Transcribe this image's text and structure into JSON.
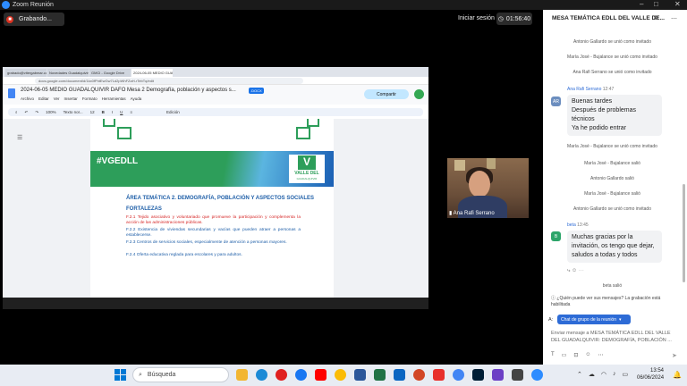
{
  "window": {
    "title": "Zoom Reunión",
    "controls": [
      "–",
      "□",
      "✕"
    ]
  },
  "zoom": {
    "recording_label": "Grabando...",
    "start_label": "Iniciar sesión",
    "timer": "01:56:40"
  },
  "shared_screen": {
    "tabs": [
      "grabado@vitergabmar.com...",
      "Novedades Guadalquivir...",
      "GMCl - Google Drive",
      "2024-06-05 MEDIO GUADALQ..."
    ],
    "url": "docs.google.com/document/d/1kx0fPhtEwGw7Ld2pWhFZaH-rTebTq/edit",
    "doc_title": "2024-06-05 MEDIO GUADALQUIVIR DAFO Mesa 2 Demografía, población y aspectos s...",
    "doc_badge": ".DOCX",
    "menus": [
      "Archivo",
      "Editar",
      "Ver",
      "Insertar",
      "Formato",
      "Herramientas",
      "Ayuda"
    ],
    "share_label": "Compartir",
    "toolbar": {
      "zoom": "100%",
      "style": "Texto nor...",
      "font_size": "12",
      "mode": "Edición"
    },
    "banner_tag": "#VGEDLL",
    "logo_line1": "VALLE DEL",
    "logo_line2": "GUADALQUIVIR",
    "area_title": "ÁREA TEMÁTICA 2. DEMOGRAFÍA, POBLACIÓN Y ASPECTOS SOCIALES",
    "section": "FORTALEZAS",
    "items": [
      "F.2.1  Tejido asociativo y voluntariado que promueve la participación y complementa la acción de las administraciones públicas.",
      "F.2.2  Existencia de viviendas secundarias y vacías que pueden atraer a personas a establecerse.",
      "F.2.3  Centros de servicios sociales, especialmente de atención a personas mayores.",
      "F.2.4  Oferta educativa reglada para escolares y para adultos."
    ]
  },
  "video": {
    "participant_name": "Ana Rafi Serrano"
  },
  "chat": {
    "title": "MESA TEMÁTICA EDLL DEL VALLE DE...",
    "system_top": [
      "Antonio Gallardo se unió como invitado",
      "María José - Bujalance se unió como invitado",
      "Ana Rafi Serrano se unió como invitado"
    ],
    "message1": {
      "avatar": "AR",
      "sender": "Ana Rafi Serrano",
      "time": "12:47",
      "lines": [
        "Buenas tardes",
        "Después de problemas técnicos",
        "Ya he podido entrar"
      ]
    },
    "system_mid": [
      "María José - Bujalance se unió como invitado",
      "María José - Bujalance salió",
      "Antonio Gallardo salió",
      "María José - Bujalance salió",
      "Antonio Gallardo se unió como invitado"
    ],
    "message2": {
      "avatar": "B",
      "sender": "beta",
      "time": "13:45",
      "text": "Muchas gracias por la invitación, os tengo que dejar, saludos a todas y todos"
    },
    "system_bottom": "beta salió",
    "notice": "¿Quién puede ver sus mensajes? La grabación está habilitada",
    "to_label": "A:",
    "to_value": "Chat de grupo de la reunión",
    "input_placeholder": "Enviar mensaje a MESA TEMÁTICA EDLL DEL VALLE DEL GUADALQUIVIR: DEMOGRAFÍA, POBLACIÓN ..."
  },
  "taskbar": {
    "search_placeholder": "Búsqueda",
    "time": "13:54",
    "date": "06/06/2024"
  },
  "colors": {
    "zoom_blue": "#2d6bd6",
    "vgedll_green": "#2d9e5a",
    "red_text": "#d62828"
  }
}
